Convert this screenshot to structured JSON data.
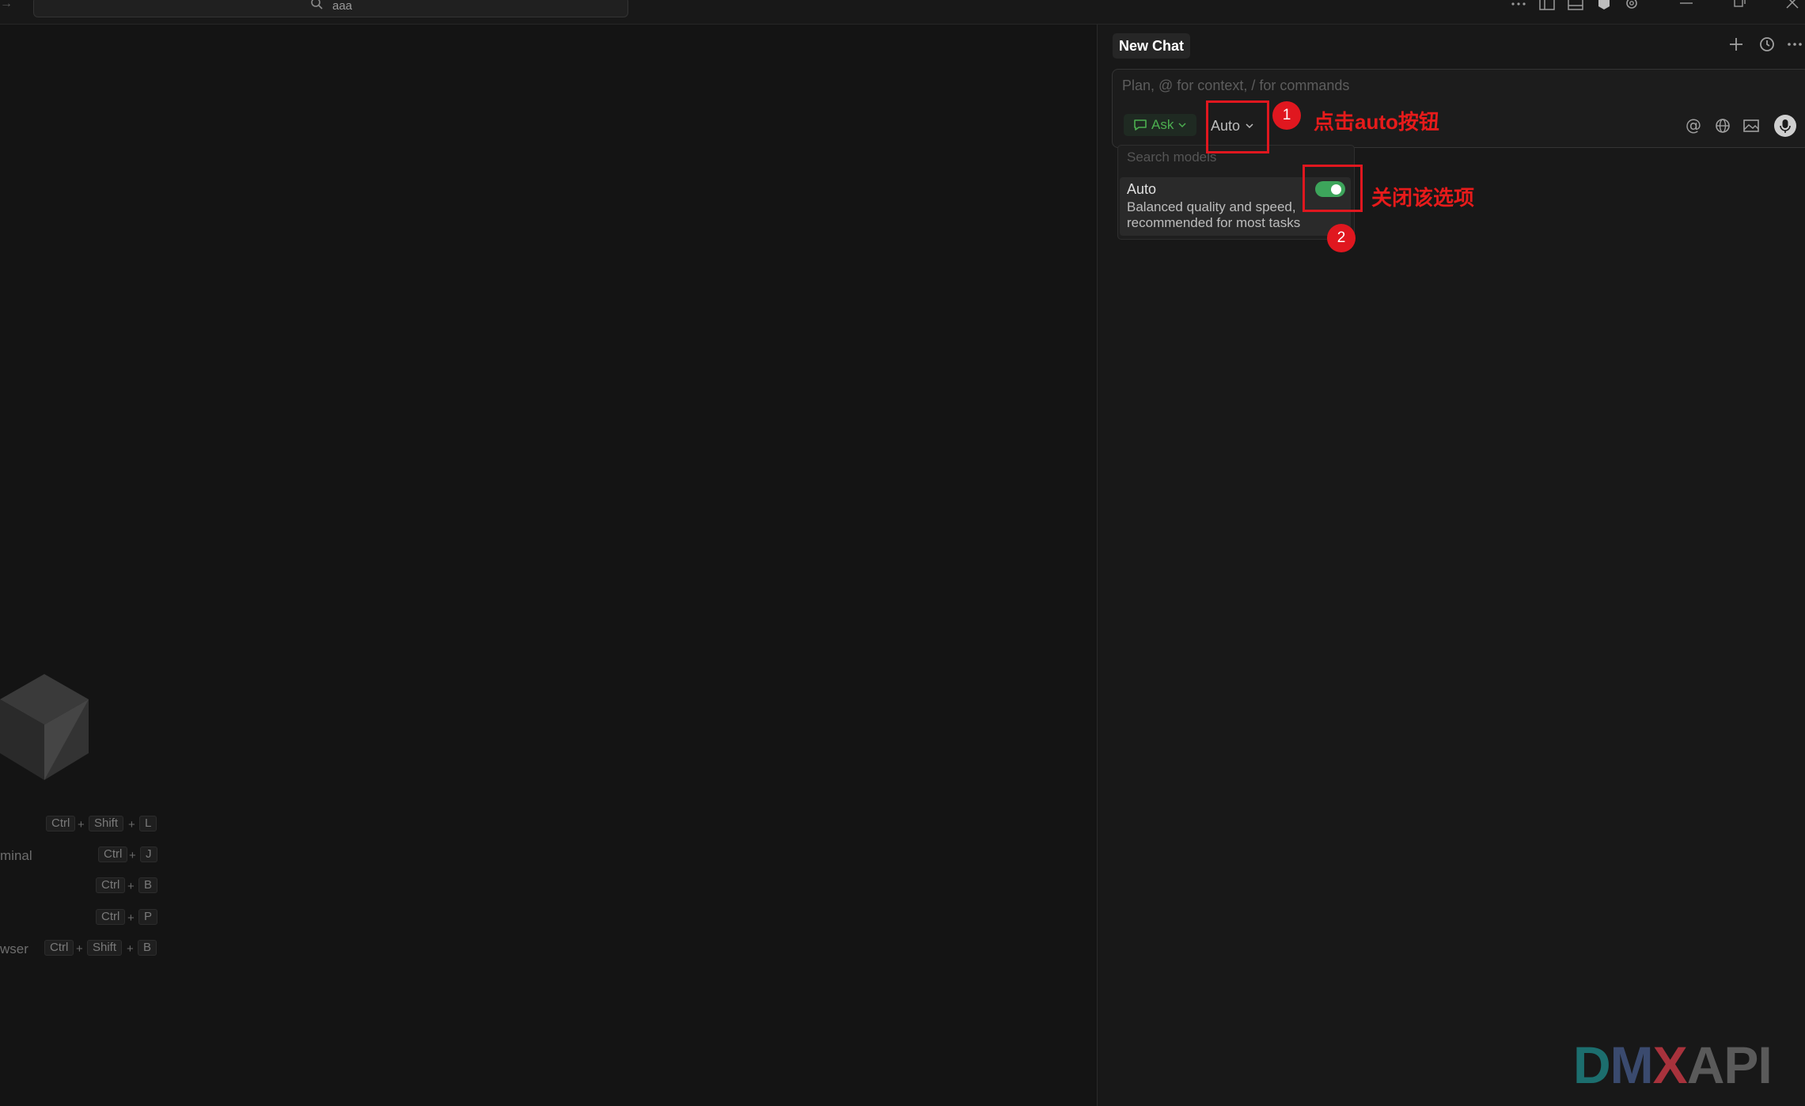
{
  "titlebar": {
    "search_value": "aaa"
  },
  "shortcuts": [
    {
      "label": "",
      "keys": [
        "Ctrl",
        "Shift",
        "L"
      ]
    },
    {
      "label": "minal",
      "keys": [
        "Ctrl",
        "J"
      ]
    },
    {
      "label": "",
      "keys": [
        "Ctrl",
        "B"
      ]
    },
    {
      "label": "",
      "keys": [
        "Ctrl",
        "P"
      ]
    },
    {
      "label": "wser",
      "keys": [
        "Ctrl",
        "Shift",
        "B"
      ]
    }
  ],
  "chat": {
    "tab_title": "New Chat",
    "input_placeholder": "Plan, @ for context, / for commands",
    "mode_label": "Ask",
    "model_label": "Auto",
    "model_search_placeholder": "Search models",
    "model_option": {
      "name": "Auto",
      "desc_line1": "Balanced quality and speed,",
      "desc_line2": "recommended for most tasks",
      "enabled": true
    }
  },
  "annotations": {
    "step1_number": "1",
    "step1_text": "点击auto按钮",
    "step2_number": "2",
    "step2_text": "关闭该选项"
  },
  "watermark": {
    "text": "DMXAPI",
    "colors": [
      "#1c6e6e",
      "#3a4a6e",
      "#a8323c",
      "#5a5a5a"
    ]
  },
  "colors": {
    "accent_green": "#3da55b",
    "annotation_red": "#e0171f",
    "background": "#141414"
  }
}
